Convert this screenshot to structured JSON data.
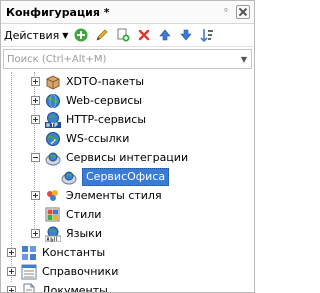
{
  "panel": {
    "title": "Конфигурация *",
    "pin_glyph": "ᵍ"
  },
  "toolbar": {
    "actions_label": "Действия"
  },
  "search": {
    "placeholder": "Поиск (Ctrl+Alt+M)"
  },
  "tree": {
    "items": [
      {
        "label": "XDTO-пакеты",
        "icon": "xdto-package-icon",
        "expander": "plus"
      },
      {
        "label": "Web-сервисы",
        "icon": "web-service-icon",
        "expander": "plus"
      },
      {
        "label": "HTTP-сервисы",
        "icon": "http-service-icon",
        "expander": "plus"
      },
      {
        "label": "WS-ссылки",
        "icon": "ws-link-icon",
        "expander": "none"
      },
      {
        "label": "Сервисы интеграции",
        "icon": "integration-service-icon",
        "expander": "minus"
      },
      {
        "label": "СервисОфиса",
        "icon": "integration-service-item-icon",
        "expander": "none",
        "selected": true
      },
      {
        "label": "Элементы стиля",
        "icon": "style-item-icon",
        "expander": "dot"
      },
      {
        "label": "Стили",
        "icon": "style-icon",
        "expander": "none"
      },
      {
        "label": "Языки",
        "icon": "language-icon",
        "expander": "plus"
      },
      {
        "label": "Константы",
        "icon": "constants-icon",
        "expander": "plus"
      },
      {
        "label": "Справочники",
        "icon": "catalogs-icon",
        "expander": "plus"
      },
      {
        "label": "Документы",
        "icon": "documents-icon",
        "expander": "plus"
      }
    ]
  }
}
